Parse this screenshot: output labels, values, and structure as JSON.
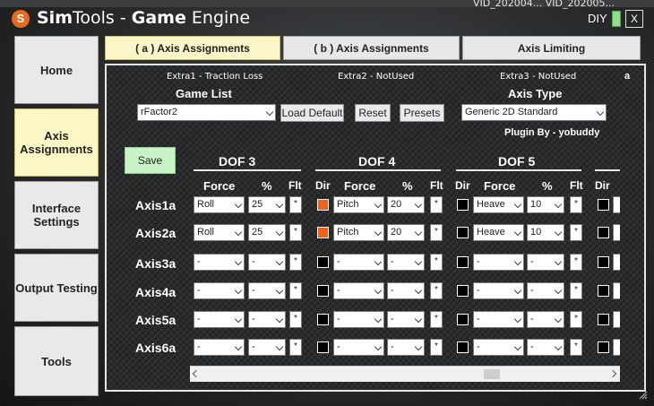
{
  "taskbar": {
    "text": "VID_202004...   VID_202005..."
  },
  "window": {
    "title_bold": "Sim",
    "title_rest": "Tools - ",
    "title_bold2": "Game",
    "title_end": " Engine",
    "logo_letter": "S",
    "diy_label": "DIY",
    "close_label": "X"
  },
  "sidebar": {
    "items": [
      {
        "label": "Home"
      },
      {
        "label": "Axis Assignments"
      },
      {
        "label": "Interface Settings"
      },
      {
        "label": "Output Testing"
      },
      {
        "label": "Tools"
      }
    ]
  },
  "tabs": [
    {
      "label": "( a ) Axis Assignments"
    },
    {
      "label": "( b ) Axis Assignments"
    },
    {
      "label": "Axis Limiting"
    }
  ],
  "panel": {
    "extra1": "Extra1 - Traction Loss",
    "extra2": "Extra2 - NotUsed",
    "extra3": "Extra3 - NotUsed",
    "corner_letter": "a",
    "game_list_label": "Game List",
    "game_selected": "rFactor2",
    "load_default": "Load Default",
    "reset": "Reset",
    "presets": "Presets",
    "axis_type_label": "Axis Type",
    "axis_type_selected": "Generic 2D Standard",
    "plugin_by": "Plugin By - yobuddy",
    "save": "Save"
  },
  "grid": {
    "dofs": [
      {
        "title": "DOF 3"
      },
      {
        "title": "DOF 4"
      },
      {
        "title": "DOF 5"
      }
    ],
    "headers": {
      "dir": "Dir",
      "force": "Force",
      "pct": "%",
      "flt": "Flt"
    },
    "flt_mark": "*",
    "axes": [
      {
        "label": "Axis1a",
        "dof3": {
          "force": "Roll",
          "pct": "25"
        },
        "dof4": {
          "dir_on": true,
          "force": "Pitch",
          "pct": "20"
        },
        "dof5": {
          "dir_on": false,
          "force": "Heave",
          "pct": "10"
        }
      },
      {
        "label": "Axis2a",
        "dof3": {
          "force": "Roll",
          "pct": "25"
        },
        "dof4": {
          "dir_on": true,
          "force": "Pitch",
          "pct": "20"
        },
        "dof5": {
          "dir_on": false,
          "force": "Heave",
          "pct": "10"
        }
      },
      {
        "label": "Axis3a",
        "dof3": {
          "force": "-",
          "pct": "-"
        },
        "dof4": {
          "dir_on": false,
          "force": "-",
          "pct": "-"
        },
        "dof5": {
          "dir_on": false,
          "force": "-",
          "pct": "-"
        }
      },
      {
        "label": "Axis4a",
        "dof3": {
          "force": "-",
          "pct": "-"
        },
        "dof4": {
          "dir_on": false,
          "force": "-",
          "pct": "-"
        },
        "dof5": {
          "dir_on": false,
          "force": "-",
          "pct": "-"
        }
      },
      {
        "label": "Axis5a",
        "dof3": {
          "force": "-",
          "pct": "-"
        },
        "dof4": {
          "dir_on": false,
          "force": "-",
          "pct": "-"
        },
        "dof5": {
          "dir_on": false,
          "force": "-",
          "pct": "-"
        }
      },
      {
        "label": "Axis6a",
        "dof3": {
          "force": "-",
          "pct": "-"
        },
        "dof4": {
          "dir_on": false,
          "force": "-",
          "pct": "-"
        },
        "dof5": {
          "dir_on": false,
          "force": "-",
          "pct": "-"
        }
      }
    ]
  },
  "colors": {
    "accent_orange": "#f1621b",
    "save_green": "#c9f3c6",
    "active_tab": "#fbf5c8"
  }
}
